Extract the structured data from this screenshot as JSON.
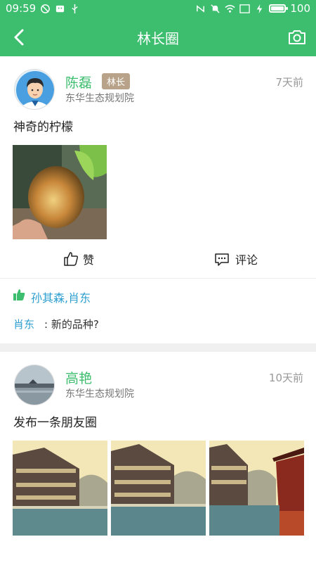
{
  "status_bar": {
    "time": "09:59",
    "battery": "100"
  },
  "header": {
    "title": "林长圈",
    "back_icon": "chevron-left-icon",
    "camera_icon": "camera-icon"
  },
  "colors": {
    "brand_green": "#3cbe6e",
    "link_blue": "#2e9fd0",
    "badge_tan": "#b8a38a"
  },
  "posts": [
    {
      "author": "陈磊",
      "badge": "林长",
      "org": "东华生态规划院",
      "time": "7天前",
      "text": "神奇的柠檬",
      "like_label": "赞",
      "comment_label": "评论",
      "likes": "孙其森,肖东",
      "comments": [
        {
          "author": "肖东",
          "text": ": 新的品种?"
        }
      ]
    },
    {
      "author": "高艳",
      "org": "东华生态规划院",
      "time": "10天前",
      "text": "发布一条朋友圈"
    }
  ]
}
